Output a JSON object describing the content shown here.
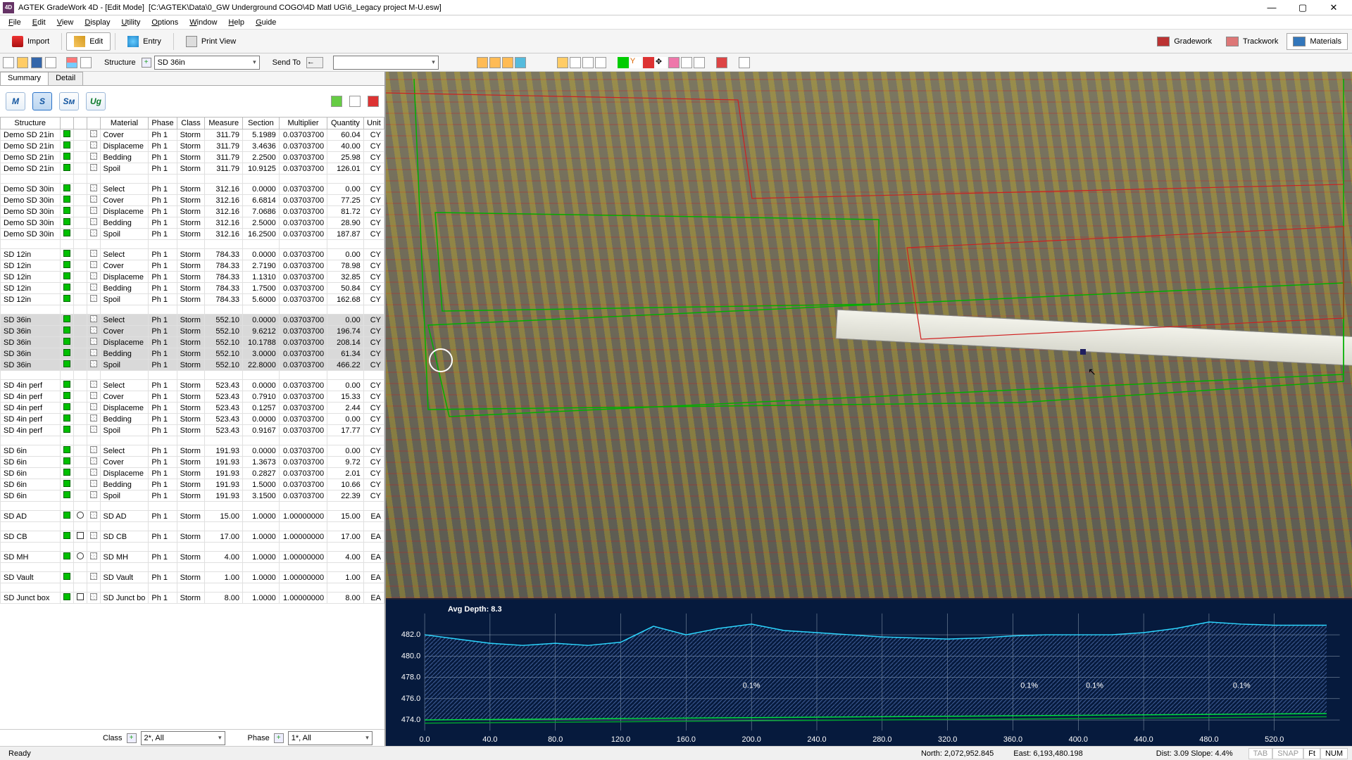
{
  "window": {
    "app": "AGTEK GradeWork 4D",
    "mode": "[Edit Mode]",
    "file": "[C:\\AGTEK\\Data\\0_GW Underground COGO\\4D Matl UG\\6_Legacy project M-U.esw]",
    "min": "—",
    "max": "▢",
    "close": "✕"
  },
  "menu": [
    "File",
    "Edit",
    "View",
    "Display",
    "Utility",
    "Options",
    "Window",
    "Help",
    "Guide"
  ],
  "tb1": {
    "import": "Import",
    "edit": "Edit",
    "entry": "Entry",
    "print": "Print View",
    "gradework": "Gradework",
    "trackwork": "Trackwork",
    "materials": "Materials"
  },
  "tb2": {
    "structure": "Structure",
    "structure_val": "SD 36in",
    "sendto": "Send To",
    "blank": ""
  },
  "tabs": {
    "summary": "Summary",
    "detail": "Detail"
  },
  "ptools": [
    "M",
    "S",
    "Sм",
    "Ug"
  ],
  "cols": [
    "Structure",
    "",
    "",
    "",
    "Material",
    "Phase",
    "Class",
    "Measure",
    "Section",
    "Multiplier",
    "Quantity",
    "Unit"
  ],
  "groups": [
    {
      "sel": false,
      "name": "Demo SD 21in",
      "rows": [
        {
          "m": "Cover",
          "ph": "Ph 1",
          "cl": "Storm",
          "me": "311.79",
          "se": "5.1989",
          "mu": "0.03703700",
          "q": "60.04",
          "u": "CY"
        },
        {
          "m": "Displaceme",
          "ph": "Ph 1",
          "cl": "Storm",
          "me": "311.79",
          "se": "3.4636",
          "mu": "0.03703700",
          "q": "40.00",
          "u": "CY"
        },
        {
          "m": "Bedding",
          "ph": "Ph 1",
          "cl": "Storm",
          "me": "311.79",
          "se": "2.2500",
          "mu": "0.03703700",
          "q": "25.98",
          "u": "CY"
        },
        {
          "m": "Spoil",
          "ph": "Ph 1",
          "cl": "Storm",
          "me": "311.79",
          "se": "10.9125",
          "mu": "0.03703700",
          "q": "126.01",
          "u": "CY"
        }
      ]
    },
    {
      "sel": false,
      "name": "Demo SD 30in",
      "rows": [
        {
          "m": "Select",
          "ph": "Ph 1",
          "cl": "Storm",
          "me": "312.16",
          "se": "0.0000",
          "mu": "0.03703700",
          "q": "0.00",
          "u": "CY"
        },
        {
          "m": "Cover",
          "ph": "Ph 1",
          "cl": "Storm",
          "me": "312.16",
          "se": "6.6814",
          "mu": "0.03703700",
          "q": "77.25",
          "u": "CY"
        },
        {
          "m": "Displaceme",
          "ph": "Ph 1",
          "cl": "Storm",
          "me": "312.16",
          "se": "7.0686",
          "mu": "0.03703700",
          "q": "81.72",
          "u": "CY"
        },
        {
          "m": "Bedding",
          "ph": "Ph 1",
          "cl": "Storm",
          "me": "312.16",
          "se": "2.5000",
          "mu": "0.03703700",
          "q": "28.90",
          "u": "CY"
        },
        {
          "m": "Spoil",
          "ph": "Ph 1",
          "cl": "Storm",
          "me": "312.16",
          "se": "16.2500",
          "mu": "0.03703700",
          "q": "187.87",
          "u": "CY"
        }
      ]
    },
    {
      "sel": false,
      "name": "SD 12in",
      "rows": [
        {
          "m": "Select",
          "ph": "Ph 1",
          "cl": "Storm",
          "me": "784.33",
          "se": "0.0000",
          "mu": "0.03703700",
          "q": "0.00",
          "u": "CY"
        },
        {
          "m": "Cover",
          "ph": "Ph 1",
          "cl": "Storm",
          "me": "784.33",
          "se": "2.7190",
          "mu": "0.03703700",
          "q": "78.98",
          "u": "CY"
        },
        {
          "m": "Displaceme",
          "ph": "Ph 1",
          "cl": "Storm",
          "me": "784.33",
          "se": "1.1310",
          "mu": "0.03703700",
          "q": "32.85",
          "u": "CY"
        },
        {
          "m": "Bedding",
          "ph": "Ph 1",
          "cl": "Storm",
          "me": "784.33",
          "se": "1.7500",
          "mu": "0.03703700",
          "q": "50.84",
          "u": "CY"
        },
        {
          "m": "Spoil",
          "ph": "Ph 1",
          "cl": "Storm",
          "me": "784.33",
          "se": "5.6000",
          "mu": "0.03703700",
          "q": "162.68",
          "u": "CY"
        }
      ]
    },
    {
      "sel": true,
      "name": "SD 36in",
      "rows": [
        {
          "m": "Select",
          "ph": "Ph 1",
          "cl": "Storm",
          "me": "552.10",
          "se": "0.0000",
          "mu": "0.03703700",
          "q": "0.00",
          "u": "CY"
        },
        {
          "m": "Cover",
          "ph": "Ph 1",
          "cl": "Storm",
          "me": "552.10",
          "se": "9.6212",
          "mu": "0.03703700",
          "q": "196.74",
          "u": "CY"
        },
        {
          "m": "Displaceme",
          "ph": "Ph 1",
          "cl": "Storm",
          "me": "552.10",
          "se": "10.1788",
          "mu": "0.03703700",
          "q": "208.14",
          "u": "CY"
        },
        {
          "m": "Bedding",
          "ph": "Ph 1",
          "cl": "Storm",
          "me": "552.10",
          "se": "3.0000",
          "mu": "0.03703700",
          "q": "61.34",
          "u": "CY"
        },
        {
          "m": "Spoil",
          "ph": "Ph 1",
          "cl": "Storm",
          "me": "552.10",
          "se": "22.8000",
          "mu": "0.03703700",
          "q": "466.22",
          "u": "CY"
        }
      ]
    },
    {
      "sel": false,
      "name": "SD 4in perf",
      "rows": [
        {
          "m": "Select",
          "ph": "Ph 1",
          "cl": "Storm",
          "me": "523.43",
          "se": "0.0000",
          "mu": "0.03703700",
          "q": "0.00",
          "u": "CY"
        },
        {
          "m": "Cover",
          "ph": "Ph 1",
          "cl": "Storm",
          "me": "523.43",
          "se": "0.7910",
          "mu": "0.03703700",
          "q": "15.33",
          "u": "CY"
        },
        {
          "m": "Displaceme",
          "ph": "Ph 1",
          "cl": "Storm",
          "me": "523.43",
          "se": "0.1257",
          "mu": "0.03703700",
          "q": "2.44",
          "u": "CY"
        },
        {
          "m": "Bedding",
          "ph": "Ph 1",
          "cl": "Storm",
          "me": "523.43",
          "se": "0.0000",
          "mu": "0.03703700",
          "q": "0.00",
          "u": "CY"
        },
        {
          "m": "Spoil",
          "ph": "Ph 1",
          "cl": "Storm",
          "me": "523.43",
          "se": "0.9167",
          "mu": "0.03703700",
          "q": "17.77",
          "u": "CY"
        }
      ]
    },
    {
      "sel": false,
      "name": "SD 6in",
      "rows": [
        {
          "m": "Select",
          "ph": "Ph 1",
          "cl": "Storm",
          "me": "191.93",
          "se": "0.0000",
          "mu": "0.03703700",
          "q": "0.00",
          "u": "CY"
        },
        {
          "m": "Cover",
          "ph": "Ph 1",
          "cl": "Storm",
          "me": "191.93",
          "se": "1.3673",
          "mu": "0.03703700",
          "q": "9.72",
          "u": "CY"
        },
        {
          "m": "Displaceme",
          "ph": "Ph 1",
          "cl": "Storm",
          "me": "191.93",
          "se": "0.2827",
          "mu": "0.03703700",
          "q": "2.01",
          "u": "CY"
        },
        {
          "m": "Bedding",
          "ph": "Ph 1",
          "cl": "Storm",
          "me": "191.93",
          "se": "1.5000",
          "mu": "0.03703700",
          "q": "10.66",
          "u": "CY"
        },
        {
          "m": "Spoil",
          "ph": "Ph 1",
          "cl": "Storm",
          "me": "191.93",
          "se": "3.1500",
          "mu": "0.03703700",
          "q": "22.39",
          "u": "CY"
        }
      ]
    }
  ],
  "singles": [
    {
      "s": "SD AD",
      "sym": "circ",
      "m": "SD AD",
      "ph": "Ph 1",
      "cl": "Storm",
      "me": "15.00",
      "se": "1.0000",
      "mu": "1.00000000",
      "q": "15.00",
      "u": "EA"
    },
    {
      "s": "SD CB",
      "sym": "sqo",
      "m": "SD CB",
      "ph": "Ph 1",
      "cl": "Storm",
      "me": "17.00",
      "se": "1.0000",
      "mu": "1.00000000",
      "q": "17.00",
      "u": "EA"
    },
    {
      "s": "SD MH",
      "sym": "circ",
      "m": "SD MH",
      "ph": "Ph 1",
      "cl": "Storm",
      "me": "4.00",
      "se": "1.0000",
      "mu": "1.00000000",
      "q": "4.00",
      "u": "EA"
    },
    {
      "s": "SD Vault",
      "sym": "",
      "m": "SD Vault",
      "ph": "Ph 1",
      "cl": "Storm",
      "me": "1.00",
      "se": "1.0000",
      "mu": "1.00000000",
      "q": "1.00",
      "u": "EA"
    },
    {
      "s": "SD Junct box",
      "sym": "sqo",
      "m": "SD Junct bo",
      "ph": "Ph 1",
      "cl": "Storm",
      "me": "8.00",
      "se": "1.0000",
      "mu": "1.00000000",
      "q": "8.00",
      "u": "EA"
    }
  ],
  "filter": {
    "class": "Class",
    "class_val": "2*, All",
    "phase": "Phase",
    "phase_val": "1*, All"
  },
  "chart_data": {
    "type": "line",
    "title": "",
    "xlabel": "",
    "ylabel": "",
    "avg_depth_label": "Avg Depth: 8.3",
    "x_ticks": [
      "0.0",
      "40.0",
      "80.0",
      "120.0",
      "160.0",
      "200.0",
      "240.0",
      "280.0",
      "320.0",
      "360.0",
      "400.0",
      "440.0",
      "480.0",
      "520.0"
    ],
    "y_ticks": [
      "474.0",
      "476.0",
      "478.0",
      "480.0",
      "482.0"
    ],
    "ylim": [
      473,
      484
    ],
    "xlim": [
      0,
      560
    ],
    "annotations": [
      {
        "x": 200,
        "y": 477,
        "t": "0.1%"
      },
      {
        "x": 370,
        "y": 477,
        "t": "0.1%"
      },
      {
        "x": 410,
        "y": 477,
        "t": "0.1%"
      },
      {
        "x": 500,
        "y": 477,
        "t": "0.1%"
      }
    ],
    "series": [
      {
        "name": "surface",
        "color": "#2bd6ff",
        "values": [
          [
            0,
            482.0
          ],
          [
            20,
            481.6
          ],
          [
            40,
            481.2
          ],
          [
            60,
            481.0
          ],
          [
            80,
            481.2
          ],
          [
            100,
            481.0
          ],
          [
            120,
            481.3
          ],
          [
            140,
            482.8
          ],
          [
            160,
            482.0
          ],
          [
            180,
            482.6
          ],
          [
            200,
            483.0
          ],
          [
            220,
            482.4
          ],
          [
            240,
            482.2
          ],
          [
            260,
            482.0
          ],
          [
            280,
            481.8
          ],
          [
            300,
            481.7
          ],
          [
            320,
            481.6
          ],
          [
            340,
            481.7
          ],
          [
            360,
            481.9
          ],
          [
            380,
            482.0
          ],
          [
            400,
            482.0
          ],
          [
            420,
            482.0
          ],
          [
            440,
            482.2
          ],
          [
            460,
            482.6
          ],
          [
            480,
            483.2
          ],
          [
            500,
            483.0
          ],
          [
            520,
            482.9
          ],
          [
            540,
            482.9
          ],
          [
            552,
            482.9
          ]
        ]
      },
      {
        "name": "bottom",
        "color": "#00e040",
        "values": [
          [
            0,
            474.0
          ],
          [
            552,
            474.6
          ]
        ]
      },
      {
        "name": "bottom2",
        "color": "#00a030",
        "values": [
          [
            0,
            473.7
          ],
          [
            552,
            474.3
          ]
        ]
      }
    ]
  },
  "status": {
    "ready": "Ready",
    "north": "North: 2,072,952.845",
    "east": "East: 6,193,480.198",
    "dist": "Dist: 3.09 Slope: 4.4%",
    "tab": "TAB",
    "snap": "SNAP",
    "ft": "Ft",
    "num": "NUM"
  }
}
